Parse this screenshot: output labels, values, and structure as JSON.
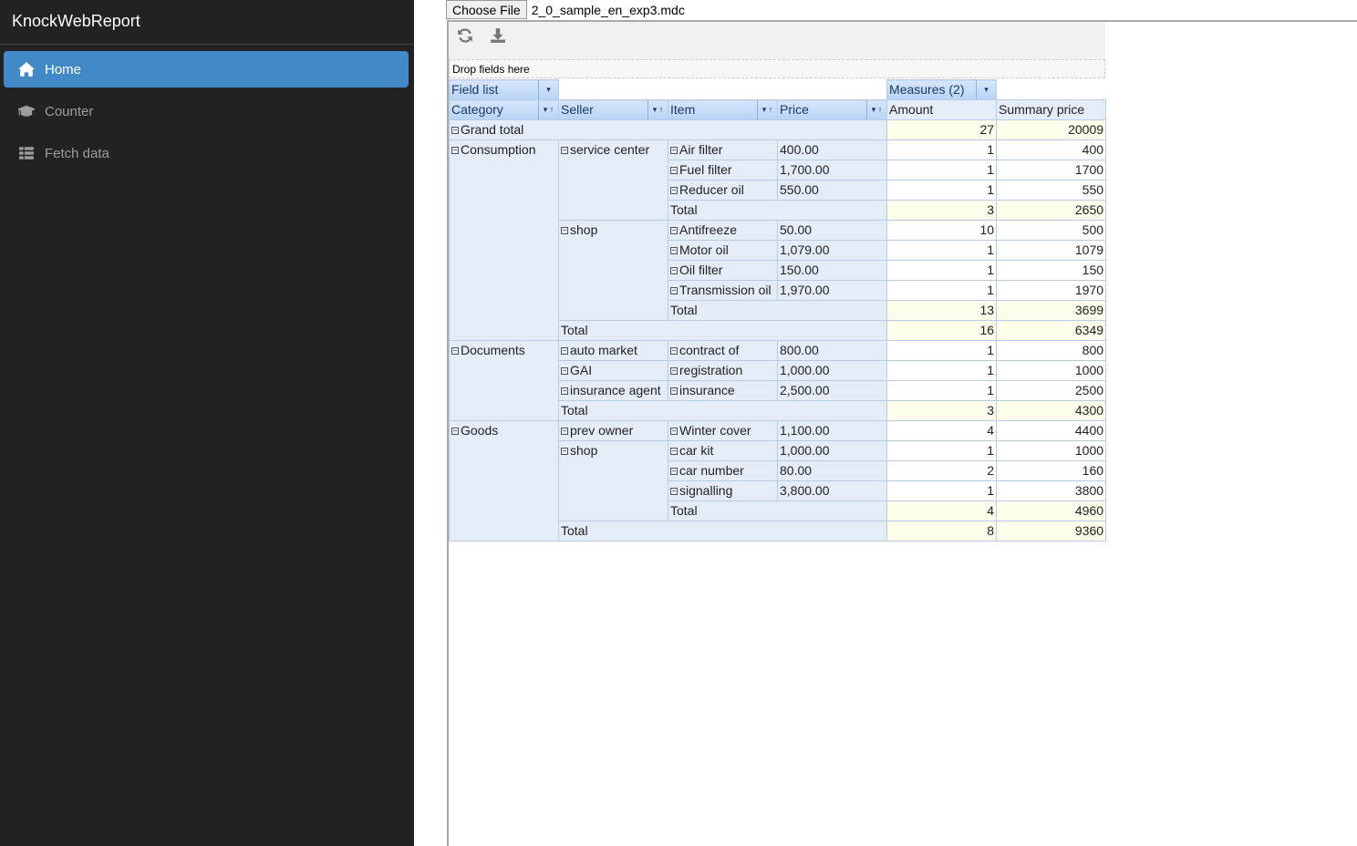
{
  "app": {
    "title": "KnockWebReport"
  },
  "nav": [
    {
      "label": "Home",
      "icon": "home-icon",
      "active": true
    },
    {
      "label": "Counter",
      "icon": "graduation-cap-icon"
    },
    {
      "label": "Fetch data",
      "icon": "list-icon"
    }
  ],
  "file": {
    "button": "Choose File",
    "name": "2_0_sample_en_exp3.mdc"
  },
  "toolbar": {
    "refresh": "refresh-icon",
    "export": "download-icon"
  },
  "pivot": {
    "drop_label": "Drop fields here",
    "field_list": "Field list",
    "measures": "Measures (2)",
    "headers": [
      "Category",
      "Seller",
      "Item",
      "Price",
      "Amount",
      "Summary price"
    ],
    "total_label": "Total",
    "grand_total": {
      "label": "Grand total",
      "amount": "27",
      "price": "20009"
    },
    "categories": [
      {
        "name": "Consumption",
        "sellers": [
          {
            "name": "service center",
            "items": [
              [
                "Air filter",
                "400.00",
                "1",
                "400"
              ],
              [
                "Fuel filter",
                "1,700.00",
                "1",
                "1700"
              ],
              [
                "Reducer oil",
                "550.00",
                "1",
                "550"
              ]
            ],
            "total": [
              "3",
              "2650"
            ]
          },
          {
            "name": "shop",
            "items": [
              [
                "Antifreeze",
                "50.00",
                "10",
                "500"
              ],
              [
                "Motor oil",
                "1,079.00",
                "1",
                "1079"
              ],
              [
                "Oil filter",
                "150.00",
                "1",
                "150"
              ],
              [
                "Transmission oil",
                "1,970.00",
                "1",
                "1970"
              ]
            ],
            "total": [
              "13",
              "3699"
            ]
          }
        ],
        "total": [
          "16",
          "6349"
        ]
      },
      {
        "name": "Documents",
        "sellers": [
          {
            "name": "auto market",
            "items": [
              [
                "contract of",
                "800.00",
                "1",
                "800"
              ]
            ]
          },
          {
            "name": "GAI",
            "items": [
              [
                "registration",
                "1,000.00",
                "1",
                "1000"
              ]
            ]
          },
          {
            "name": "insurance agent",
            "items": [
              [
                "insurance",
                "2,500.00",
                "1",
                "2500"
              ]
            ]
          }
        ],
        "total": [
          "3",
          "4300"
        ]
      },
      {
        "name": "Goods",
        "sellers": [
          {
            "name": "prev owner",
            "items": [
              [
                "Winter cover",
                "1,100.00",
                "4",
                "4400"
              ]
            ]
          },
          {
            "name": "shop",
            "items": [
              [
                "car kit",
                "1,000.00",
                "1",
                "1000"
              ],
              [
                "car number",
                "80.00",
                "2",
                "160"
              ],
              [
                "signalling",
                "3,800.00",
                "1",
                "3800"
              ]
            ],
            "total": [
              "4",
              "4960"
            ]
          }
        ],
        "total": [
          "8",
          "9360"
        ]
      }
    ]
  }
}
